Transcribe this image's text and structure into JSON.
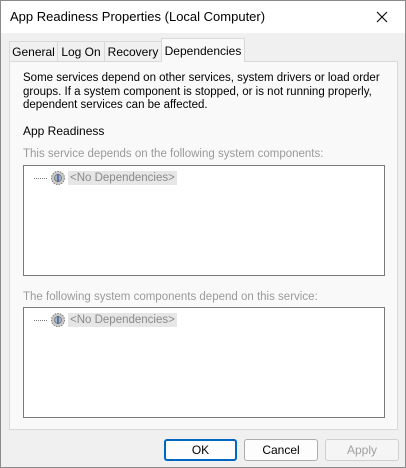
{
  "window": {
    "title": "App Readiness Properties (Local Computer)"
  },
  "tabs": [
    {
      "label": "General",
      "active": false
    },
    {
      "label": "Log On",
      "active": false
    },
    {
      "label": "Recovery",
      "active": false
    },
    {
      "label": "Dependencies",
      "active": true
    }
  ],
  "dependencies": {
    "description": "Some services depend on other services, system drivers or load order groups. If a system component is stopped, or is not running properly, dependent services can be affected.",
    "service_name": "App Readiness",
    "depends_on_label": "This service depends on the following system components:",
    "depends_on_items": [
      "<No Dependencies>"
    ],
    "dependents_label": "The following system components depend on this service:",
    "dependents_items": [
      "<No Dependencies>"
    ]
  },
  "buttons": {
    "ok": "OK",
    "cancel": "Cancel",
    "apply": "Apply"
  },
  "icons": {
    "tree_item": "gears-icon",
    "close": "close-icon"
  }
}
